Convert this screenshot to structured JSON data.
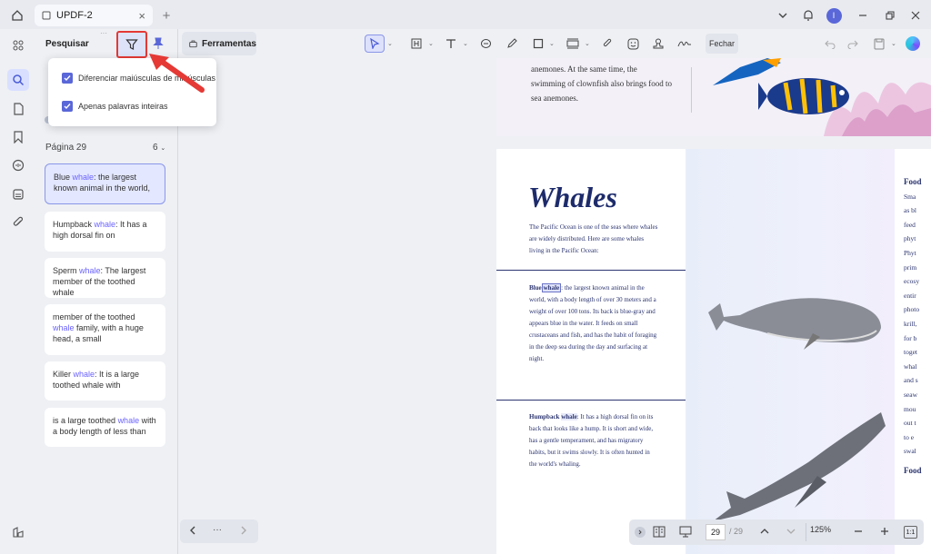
{
  "tab": {
    "title": "UPDF-2"
  },
  "search_panel": {
    "title": "Pesquisar",
    "options": [
      {
        "label": "Diferenciar maiúsculas de minúsculas",
        "checked": true
      },
      {
        "label": "Apenas palavras inteiras",
        "checked": true
      }
    ],
    "page_label": "Página 29",
    "page_count": "6",
    "results": [
      {
        "pre": "Blue ",
        "match": "whale",
        "post": ": the largest known animal in the world,"
      },
      {
        "pre": "Humpback ",
        "match": "whale",
        "post": ": It has a high dorsal fin on"
      },
      {
        "pre": "Sperm ",
        "match": "whale",
        "post": ": The largest member of the toothed whale"
      },
      {
        "pre": "member of the toothed ",
        "match": "whale",
        "post": " family, with a huge head, a small"
      },
      {
        "pre": "Killer ",
        "match": "whale",
        "post": ": It is a large toothed whale with"
      },
      {
        "pre": "is a large toothed ",
        "match": "whale",
        "post": " with a body length of less than"
      }
    ]
  },
  "toolbar": {
    "tools_label": "Ferramentas",
    "close_label": "Fechar"
  },
  "document": {
    "top_text": [
      "anemones. At the same time, the",
      "swimming of clownfish also brings food to",
      "sea anemones."
    ],
    "heading": "Whales",
    "intro": [
      "The Pacific Ocean is one of the seas where whales",
      "are widely distributed. Here are some whales",
      "living in the Pacific Ocean:"
    ],
    "blue_whale": {
      "label": "Blue",
      "match": "whale",
      "lines": [
        ": the largest known animal in the",
        "world, with a body length of over 30 meters and a",
        "weight of over 100 tons. Its back is blue-gray and",
        "appears blue in the water. It feeds on small",
        "crustaceans and fish, and has the habit of foraging",
        "in the deep sea during the day and surfacing at",
        "night."
      ]
    },
    "humpback": {
      "label": "Humpback",
      "match": "whale",
      "lines": [
        ": It has a high dorsal fin on its",
        "back that looks like a hump. It is short and wide,",
        "has a gentle temperament, and has migratory",
        "habits, but it swims slowly. It is often hunted in",
        "the world's whaling."
      ]
    },
    "right_col": [
      "Food",
      "Sma",
      "as bl",
      "feed",
      "phyt",
      "Phyt",
      "prim",
      "ecosy",
      "entir",
      "photo",
      "krill,",
      "for b",
      "toget",
      "whal",
      "and s",
      "seaw",
      "mou",
      "out t",
      "to e",
      "swal",
      "Food"
    ]
  },
  "pager": {
    "ellipsis": "···"
  },
  "zoom": {
    "page": "29",
    "total": "/ 29",
    "level": "125%"
  },
  "colors": {
    "accent": "#5a67d8",
    "highlight": "#6b63ff",
    "callout": "#e53935"
  }
}
